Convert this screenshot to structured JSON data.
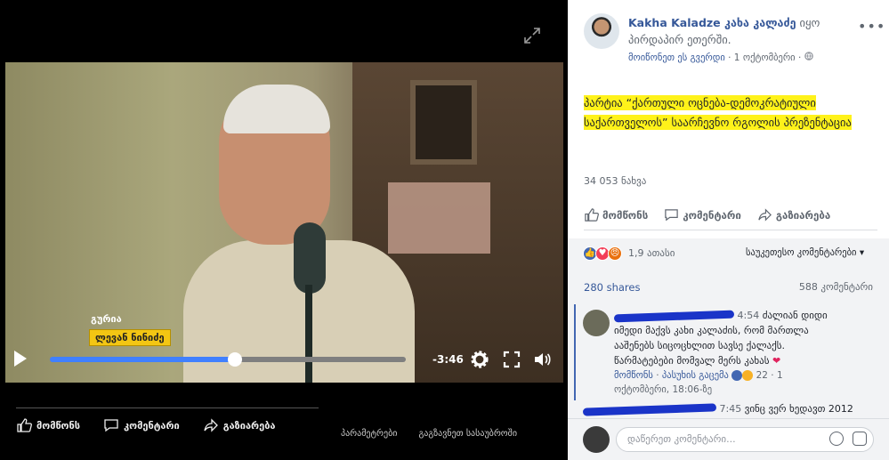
{
  "video": {
    "caption_name": "გურია",
    "caption_label": "ლევან ნინიძე",
    "time_remaining": "-3:46",
    "progress": 0.52
  },
  "left_actions": {
    "like": "მომწონს",
    "comment": "კომენტარი",
    "share": "გაზიარება"
  },
  "left_links": [
    "პარამეტრები",
    "გაგზავნეთ სასაუბროში"
  ],
  "post": {
    "author_name": "Kakha Kaladze კახა კალაძე",
    "author_action": "იყო პირდაპირ ეთერში.",
    "meta_page_like": "მოიწონეთ ეს გვერდი",
    "meta_separator": " · ",
    "meta_date": "1 ოქტომბერი · ",
    "text_line1": "პარტია “ქართული ოცნება-დემოკრატიული",
    "text_line2": "საქართველოს” საარჩევნო რგოლის პრეზენტაცია",
    "views": "34 053 ნახვა"
  },
  "actions": {
    "like": "მომწონს",
    "comment": "კომენტარი",
    "share": "გაზიარება"
  },
  "reactions": {
    "count": "1,9 ათასი",
    "sort": "საუკეთესო კომენტარები ▾"
  },
  "shares": "280 shares",
  "comment_count": "588 კომენტარი",
  "comments": [
    {
      "time": "4:54",
      "text": "ძალიან დიდი იმედი მაქვს კახი კალაძის, რომ მართლა ააშენებს სიცოცხლით სავსე ქალაქს. წარმატებები მომვალ მერს კახას",
      "like_link": "მომწონს",
      "reply_link": "პასუხის გაცემა",
      "reaction_count": "22",
      "date": "1 ოქტომბერი, 18:06-ზე"
    },
    {
      "time": "7:45",
      "text": "ვინც ვერ ხედავთ 2012"
    }
  ],
  "compose_placeholder": "დაწერეთ კომენტარი...",
  "colors": {
    "link": "#365899",
    "highlight": "#fff21a",
    "progress": "#4080ff"
  }
}
